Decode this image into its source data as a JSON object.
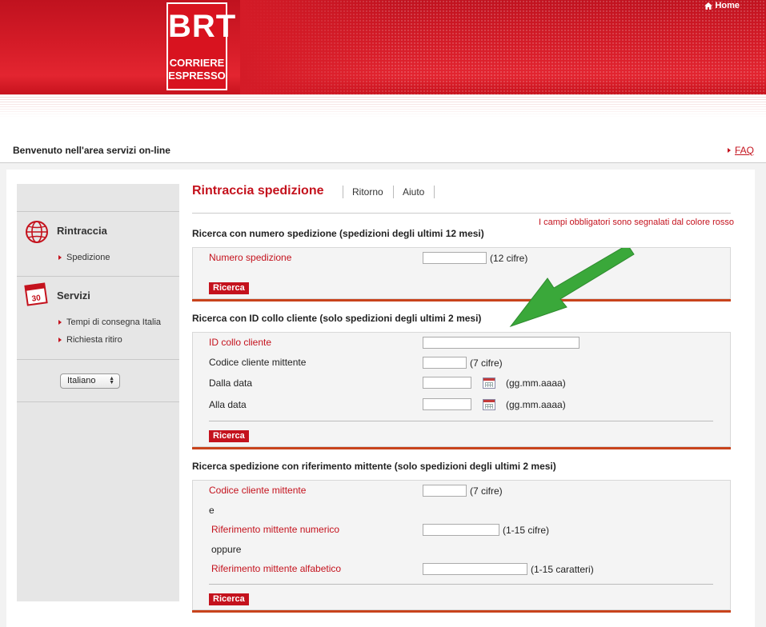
{
  "header": {
    "logo_main": "BRT",
    "logo_line1": "CORRIERE",
    "logo_line2": "ESPRESSO",
    "home_label": "Home"
  },
  "topbar": {
    "welcome": "Benvenuto  nell'area servizi on-line",
    "faq": "FAQ"
  },
  "sidebar": {
    "sections": [
      {
        "title": "Rintraccia",
        "icon": "globe-icon",
        "items": [
          "Spedizione"
        ]
      },
      {
        "title": "Servizi",
        "icon": "calendar-icon",
        "calendar_number": "30",
        "items": [
          "Tempi di consegna Italia",
          "Richiesta ritiro"
        ]
      }
    ],
    "language": "Italiano"
  },
  "main": {
    "title": "Rintraccia spedizione",
    "nav": [
      "Ritorno",
      "Aiuto"
    ],
    "mandatory_note": "I campi obbligatori sono segnalati dal colore rosso",
    "search_button": "Ricerca",
    "section1": {
      "title": "Ricerca con numero spedizione (spedizioni degli ultimi 12 mesi)",
      "field_label": "Numero spedizione",
      "field_hint": "(12 cifre)"
    },
    "section2": {
      "title": "Ricerca con ID collo cliente (solo spedizioni degli ultimi 2 mesi)",
      "id_label": "ID collo cliente",
      "code_label": "Codice cliente mittente",
      "code_hint": "(7 cifre)",
      "from_label": "Dalla data",
      "to_label": "Alla data",
      "date_hint": "(gg.mm.aaaa)"
    },
    "section3": {
      "title": "Ricerca spedizione con riferimento mittente (solo spedizioni degli ultimi 2 mesi)",
      "code_label": "Codice cliente mittente",
      "code_hint": "(7 cifre)",
      "and_label": "e",
      "numeric_label": "Riferimento mittente numerico",
      "numeric_hint": "(1-15 cifre)",
      "or_label": "oppure",
      "alpha_label": "Riferimento mittente alfabetico",
      "alpha_hint": "(1-15 caratteri)"
    }
  },
  "colors": {
    "brand_red": "#c4121d",
    "accent_orange": "#c8431c",
    "arrow_green": "#3aa83a"
  }
}
